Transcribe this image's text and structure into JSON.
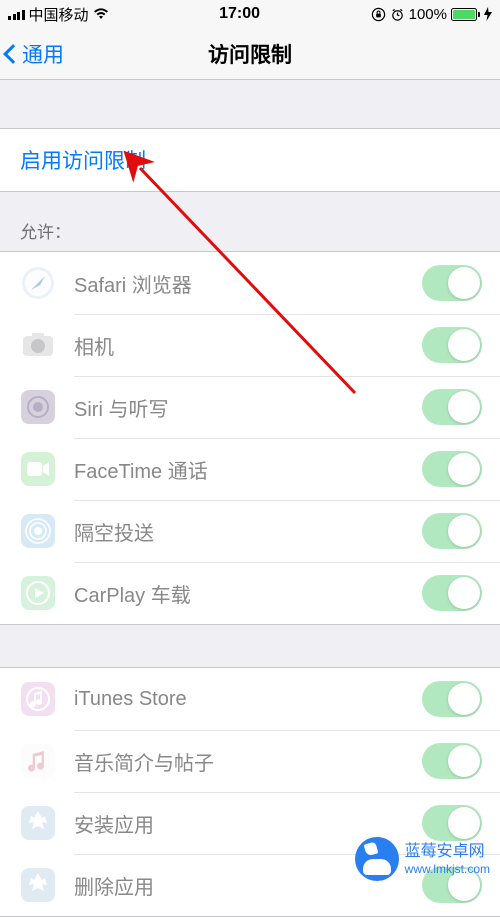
{
  "status": {
    "carrier": "中国移动",
    "wifi_icon": "wifi-icon",
    "time": "17:00",
    "lock_icon": "orientation-lock-icon",
    "alarm_icon": "alarm-icon",
    "battery_pct": "100%",
    "charging": true
  },
  "nav": {
    "back_label": "通用",
    "title": "访问限制"
  },
  "enable": {
    "label": "启用访问限制"
  },
  "section_allow": {
    "header": "允许："
  },
  "group1": [
    {
      "id": "safari",
      "label": "Safari 浏览器",
      "icon_bg": "#d9e8f4",
      "icon_fg": "#5aa3d8",
      "on": true
    },
    {
      "id": "camera",
      "label": "相机",
      "icon_bg": "#d2d2d4",
      "icon_fg": "#9a9a9d",
      "on": true
    },
    {
      "id": "siri",
      "label": "Siri 与听写",
      "icon_bg": "#b7adc4",
      "icon_fg": "#7b6c92",
      "on": true
    },
    {
      "id": "facetime",
      "label": "FaceTime 通话",
      "icon_bg": "#b1e8b6",
      "icon_fg": "#5dc46a",
      "on": true
    },
    {
      "id": "airdrop",
      "label": "隔空投送",
      "icon_bg": "#b9d8ef",
      "icon_fg": "#6eb2e2",
      "on": true
    },
    {
      "id": "carplay",
      "label": "CarPlay 车载",
      "icon_bg": "#b8e8c0",
      "icon_fg": "#5cc673",
      "on": true
    }
  ],
  "group2": [
    {
      "id": "itunes",
      "label": "iTunes Store",
      "icon_bg": "#e9c6e4",
      "icon_fg": "#cf8bc7",
      "on": true
    },
    {
      "id": "music",
      "label": "音乐简介与帖子",
      "icon_bg": "#f1e0e4",
      "icon_fg": "#e39fb3",
      "on": true
    },
    {
      "id": "install",
      "label": "安装应用",
      "icon_bg": "#c8d9eb",
      "icon_fg": "#8fb4d8",
      "on": true
    },
    {
      "id": "remove",
      "label": "删除应用",
      "icon_bg": "#c8d9eb",
      "icon_fg": "#8fb4d8",
      "on": true
    }
  ],
  "watermark": {
    "line1": "蓝莓安卓网",
    "line2": "www.lmkjst.com"
  }
}
